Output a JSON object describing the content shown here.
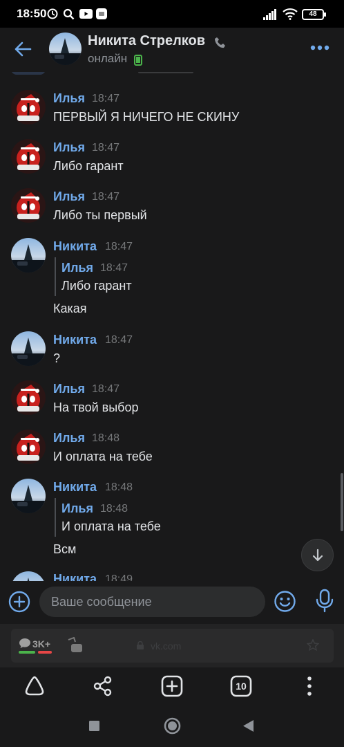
{
  "status_bar": {
    "time": "18:50",
    "battery": "48"
  },
  "header": {
    "contact_name": "Никита Стрелков",
    "contact_status": "онлайн"
  },
  "messages": [
    {
      "sender": "Илья",
      "time": "18:47",
      "text": "ПЕРВЫЙ Я НИЧЕГО НЕ СКИНУ"
    },
    {
      "sender": "Илья",
      "time": "18:47",
      "text": "Либо гарант"
    },
    {
      "sender": "Илья",
      "time": "18:47",
      "text": "Либо ты первый"
    },
    {
      "sender": "Никита",
      "time": "18:47",
      "quote": {
        "sender": "Илья",
        "time": "18:47",
        "text": "Либо гарант"
      },
      "text": "Какая"
    },
    {
      "sender": "Никита",
      "time": "18:47",
      "text": "?"
    },
    {
      "sender": "Илья",
      "time": "18:47",
      "text": "На твой выбор"
    },
    {
      "sender": "Илья",
      "time": "18:48",
      "text": "И оплата на тебе"
    },
    {
      "sender": "Никита",
      "time": "18:48",
      "quote": {
        "sender": "Илья",
        "time": "18:48",
        "text": "И оплата на тебе"
      },
      "text": "Всм"
    },
    {
      "sender": "Никита",
      "time": "18:49",
      "text": ""
    }
  ],
  "input": {
    "placeholder": "Ваше сообщение"
  },
  "browser": {
    "comments_badge": "3K+",
    "url": "vk.com",
    "tabs_count": "10"
  },
  "colors": {
    "background": "#19191a",
    "accent_blue": "#71aaeb",
    "online_green": "#4bb34b",
    "deadpool_red": "#c8211e"
  },
  "icons": {
    "back": "arrow-left-icon",
    "more": "three-dots-icon",
    "attach": "plus-circle-icon",
    "emoji": "smile-icon",
    "voice": "microphone-icon",
    "scroll_down": "arrow-down-icon",
    "home": "triangle-home-icon",
    "share": "share-icon",
    "new_tab": "plus-square-icon",
    "menu": "vertical-dots-icon"
  }
}
